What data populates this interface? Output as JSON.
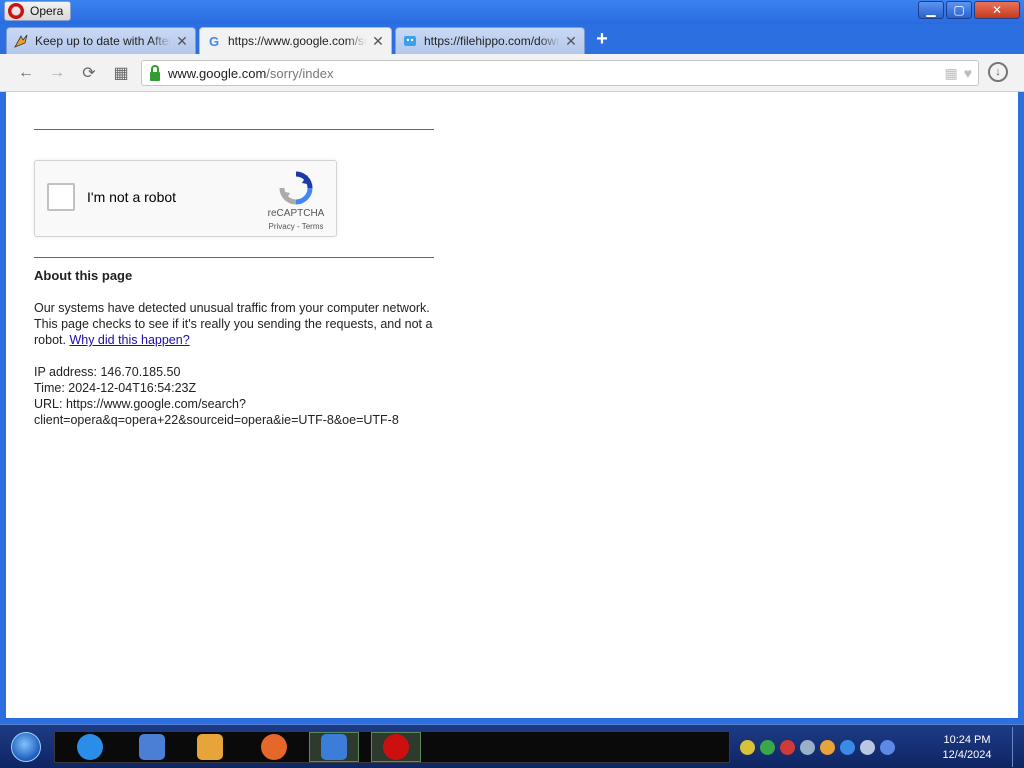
{
  "window": {
    "app_name": "Opera",
    "controls": {
      "minimize": "▁",
      "maximize": "▢",
      "close": "✕"
    }
  },
  "tabs": [
    {
      "title": "Keep up to date with AfterDawn",
      "favicon": "afterdawn-icon",
      "active": false,
      "close": "✕"
    },
    {
      "title": "https://www.google.com/sorry/index",
      "favicon": "google-icon",
      "active": true,
      "close": "✕"
    },
    {
      "title": "https://filehippo.com/download",
      "favicon": "filehippo-icon",
      "active": false,
      "close": "✕"
    }
  ],
  "new_tab": "+",
  "toolbar": {
    "back": "←",
    "forward": "→",
    "reload": "⟳",
    "speed_dial": "▦",
    "url_host": "www.google.com",
    "url_path": "/sorry/index",
    "download": "↓"
  },
  "page": {
    "captcha": {
      "label": "I'm not a robot",
      "brand": "reCAPTCHA",
      "privacy": "Privacy",
      "separator": " - ",
      "terms": "Terms"
    },
    "about_title": "About this page",
    "paragraph": "Our systems have detected unusual traffic from your computer network. This page checks to see if it's really you sending the requests, and not a robot.",
    "why_link": "Why did this happen?",
    "ip_line": "IP address: 146.70.185.50",
    "time_line": "Time: 2024-12-04T16:54:23Z",
    "url_line_1": "URL: https://www.google.com/search?",
    "url_line_2": "client=opera&q=opera+22&sourceid=opera&ie=UTF-8&oe=UTF-8"
  },
  "taskbar": {
    "apps": [
      {
        "name": "ie-icon",
        "color": "#2a8ee8"
      },
      {
        "name": "books-icon",
        "color": "#4b7fd6"
      },
      {
        "name": "media-player-icon",
        "color": "#e6a43a"
      },
      {
        "name": "firefox-icon",
        "color": "#e5672a"
      },
      {
        "name": "image-viewer-icon",
        "color": "#3b7dd8"
      },
      {
        "name": "opera-icon",
        "color": "#cc1010"
      }
    ],
    "clock_time": "10:24 PM",
    "clock_date": "12/4/2024"
  }
}
